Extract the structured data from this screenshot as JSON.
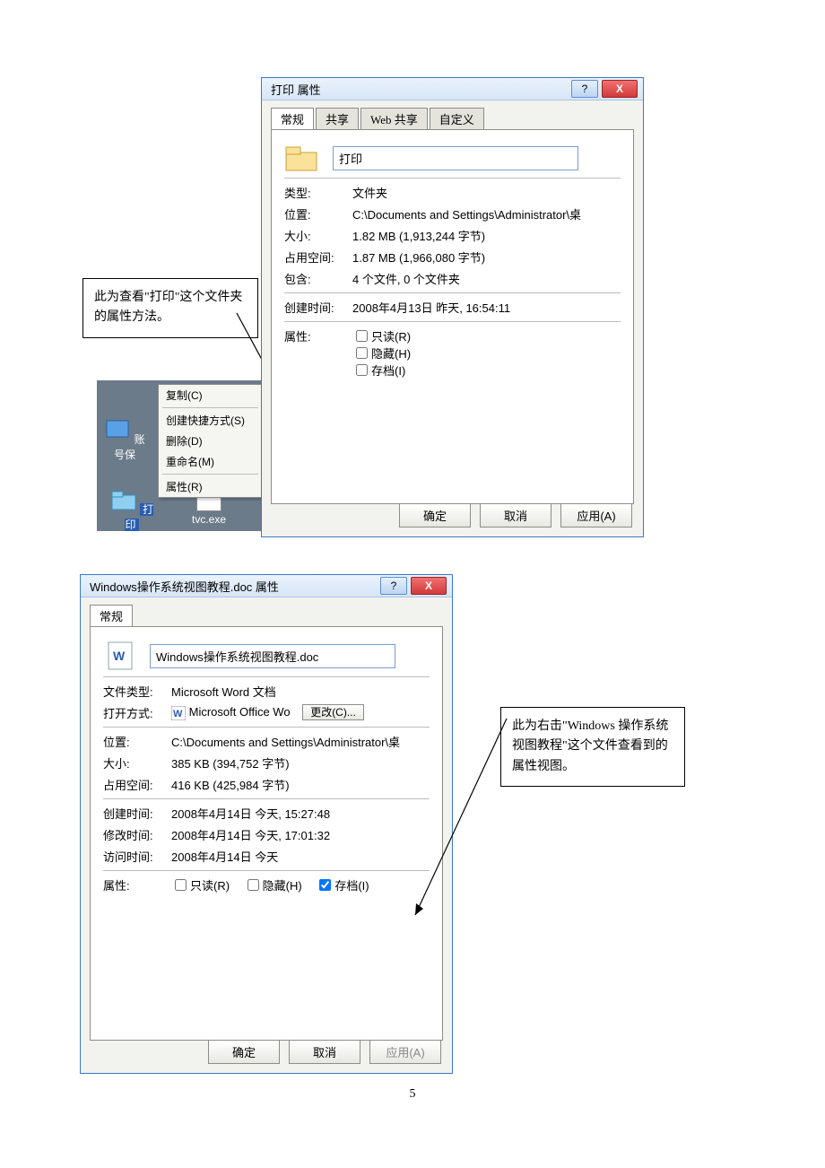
{
  "page_number": "5",
  "callout1": "此为查看\"打印\"这个文件夹的属性方法。",
  "callout2": "此为右击\"Windows 操作系统视图教程\"这个文件查看到的属性视图。",
  "dlg1": {
    "title": "打印 属性",
    "tabs": [
      "常规",
      "共享",
      "Web 共享",
      "自定义"
    ],
    "name": "打印",
    "rows": {
      "type_k": "类型:",
      "type_v": "文件夹",
      "loc_k": "位置:",
      "loc_v": "C:\\Documents and Settings\\Administrator\\桌",
      "size_k": "大小:",
      "size_v": "1.82 MB (1,913,244 字节)",
      "disk_k": "占用空间:",
      "disk_v": "1.87 MB (1,966,080 字节)",
      "cont_k": "包含:",
      "cont_v": "4 个文件, 0 个文件夹",
      "ctime_k": "创建时间:",
      "ctime_v": "2008年4月13日 昨天, 16:54:11",
      "attr_k": "属性:"
    },
    "attrs": {
      "ro": "只读(R)",
      "hid": "隐藏(H)",
      "arc": "存档(I)"
    },
    "buttons": {
      "ok": "确定",
      "cancel": "取消",
      "apply": "应用(A)"
    }
  },
  "dlg2": {
    "title": "Windows操作系统视图教程.doc 属性",
    "tab": "常规",
    "name": "Windows操作系统视图教程.doc",
    "rows": {
      "ftype_k": "文件类型:",
      "ftype_v": "Microsoft Word 文档",
      "open_k": "打开方式:",
      "open_v": "Microsoft Office Wo",
      "change": "更改(C)...",
      "loc_k": "位置:",
      "loc_v": "C:\\Documents and Settings\\Administrator\\桌",
      "size_k": "大小:",
      "size_v": "385 KB (394,752 字节)",
      "disk_k": "占用空间:",
      "disk_v": "416 KB (425,984 字节)",
      "ctime_k": "创建时间:",
      "ctime_v": "2008年4月14日 今天, 15:27:48",
      "mtime_k": "修改时间:",
      "mtime_v": "2008年4月14日 今天, 17:01:32",
      "atime_k": "访问时间:",
      "atime_v": "2008年4月14日 今天"
    },
    "attr_k": "属性:",
    "attrs": {
      "ro": "只读(R)",
      "hid": "隐藏(H)",
      "arc": "存档(I)"
    },
    "buttons": {
      "ok": "确定",
      "cancel": "取消",
      "apply": "应用(A)"
    }
  },
  "desktop": {
    "icon1": "账号保",
    "icon2": "打印",
    "icon3": "tvc.exe",
    "menu": [
      "复制(C)",
      "创建快捷方式(S)",
      "删除(D)",
      "重命名(M)",
      "属性(R)"
    ]
  }
}
